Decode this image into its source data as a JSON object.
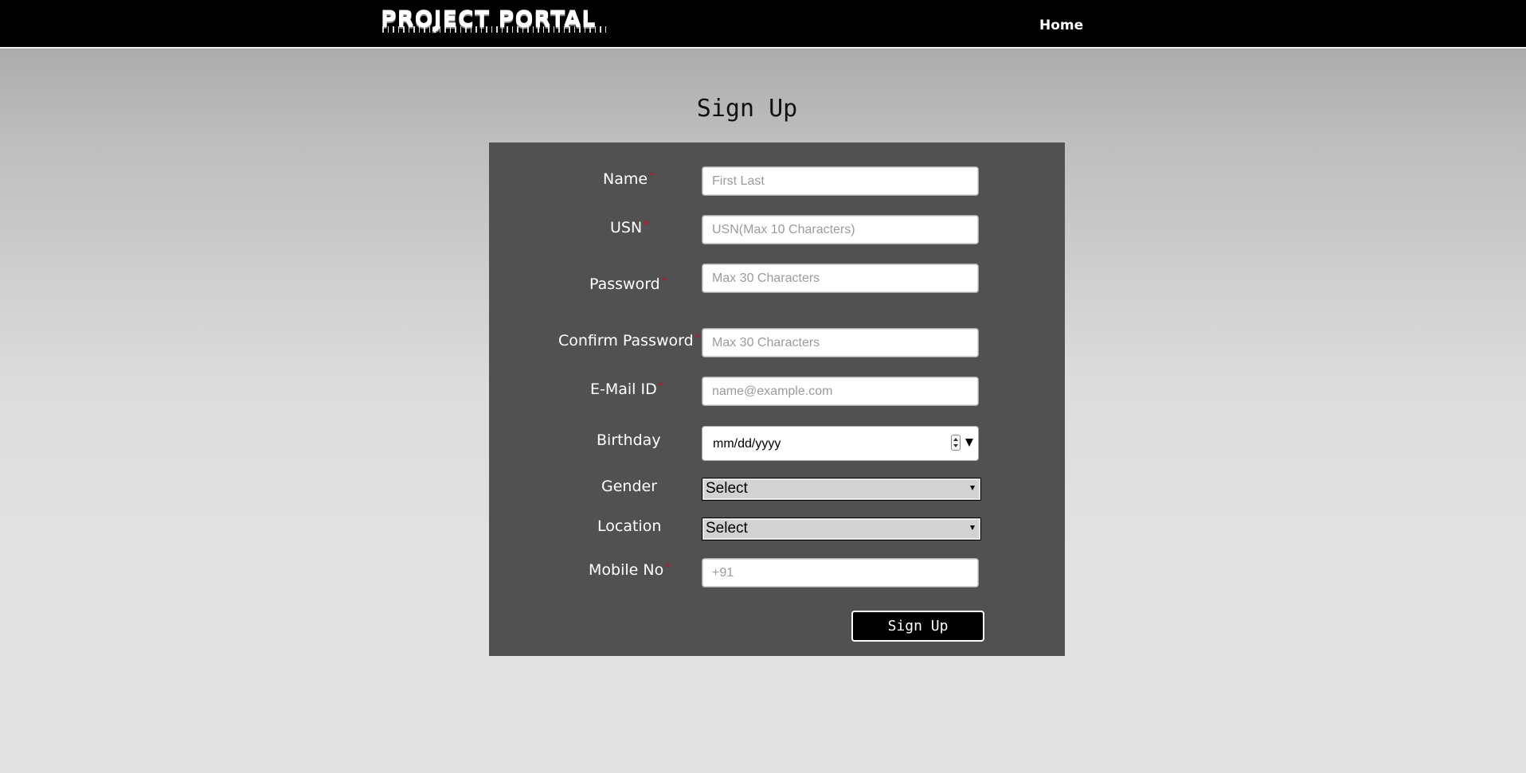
{
  "header": {
    "logo_text": "PROJECT PORTAL",
    "nav_home": "Home"
  },
  "page": {
    "title": "Sign Up"
  },
  "form": {
    "name": {
      "label": "Name",
      "required": "*",
      "placeholder": "First Last",
      "value": ""
    },
    "usn": {
      "label": "USN",
      "required": "*",
      "placeholder": "USN(Max 10 Characters)",
      "value": ""
    },
    "password": {
      "label": "Password",
      "required": "*",
      "placeholder": "Max 30 Characters",
      "value": ""
    },
    "confirm_password": {
      "label": "Confirm Password",
      "required": "*",
      "placeholder": "Max 30 Characters",
      "value": ""
    },
    "email": {
      "label": "E-Mail ID",
      "required": "*",
      "placeholder": "name@example.com",
      "value": ""
    },
    "birthday": {
      "label": "Birthday",
      "value": "mm/dd/yyyy"
    },
    "gender": {
      "label": "Gender",
      "selected": "Select"
    },
    "location": {
      "label": "Location",
      "selected": "Select"
    },
    "mobile": {
      "label": "Mobile No",
      "required": "*",
      "placeholder": "+91",
      "value": ""
    },
    "submit_label": "Sign Up"
  },
  "colors": {
    "topbar": "#000000",
    "panel": "#515151",
    "required_mark": "#c8102e",
    "button": "#000000"
  }
}
